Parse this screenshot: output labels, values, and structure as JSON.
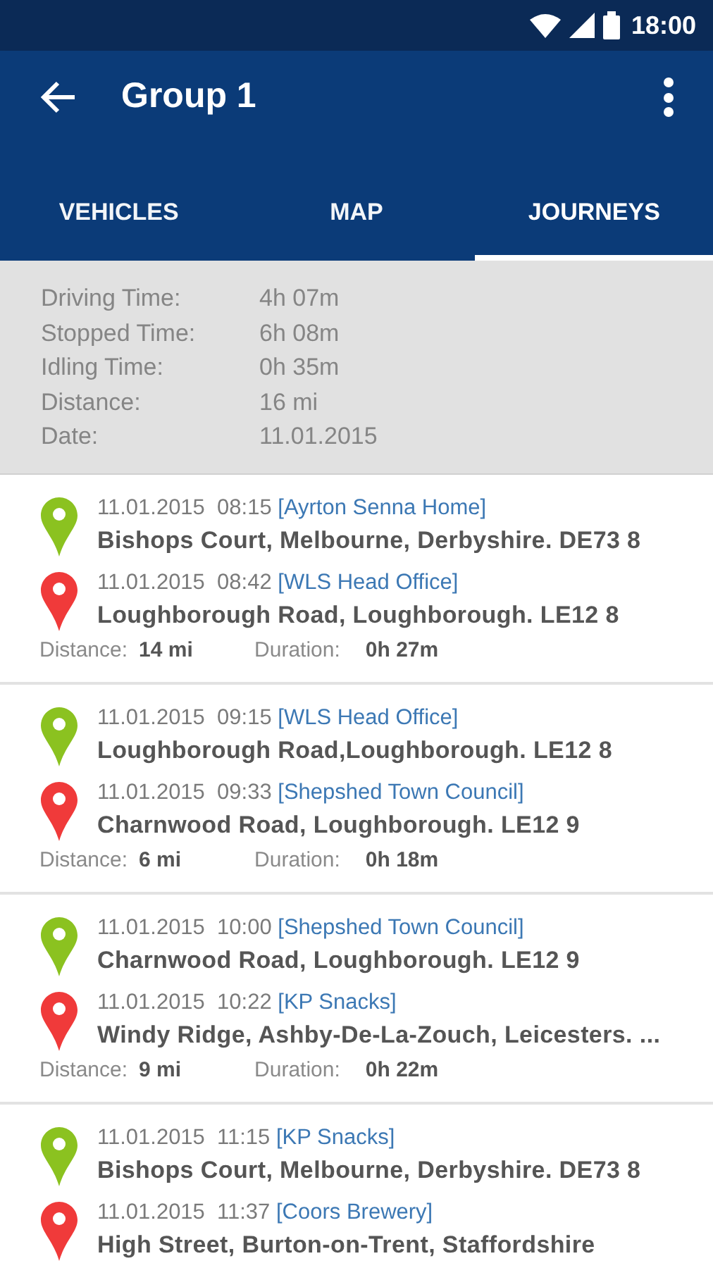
{
  "status_bar": {
    "time": "18:00"
  },
  "app_bar": {
    "title": "Group 1"
  },
  "tabs": [
    {
      "label": "VEHICLES",
      "selected": false
    },
    {
      "label": "MAP",
      "selected": false
    },
    {
      "label": "JOURNEYS",
      "selected": true
    }
  ],
  "summary": [
    {
      "label": "Driving Time:",
      "value": "4h 07m"
    },
    {
      "label": "Stopped Time:",
      "value": "6h 08m"
    },
    {
      "label": "Idling Time:",
      "value": "0h 35m"
    },
    {
      "label": "Distance:",
      "value": "16 mi"
    },
    {
      "label": "Date:",
      "value": "11.01.2015"
    }
  ],
  "journeys": [
    {
      "stops": [
        {
          "kind": "start",
          "date_time": "11.01.2015  08:15",
          "place": "[Ayrton Senna  Home]",
          "address": "Bishops Court, Melbourne, Derbyshire. DE73 8"
        },
        {
          "kind": "end",
          "date_time": "11.01.2015  08:42",
          "place": "[WLS Head Office]",
          "address": "Loughborough Road, Loughborough. LE12 8"
        }
      ],
      "distance_label": "Distance:",
      "distance": "14 mi",
      "duration_label": "Duration:",
      "duration": "0h 27m"
    },
    {
      "stops": [
        {
          "kind": "start",
          "date_time": "11.01.2015  09:15",
          "place": "[WLS Head Office]",
          "address": "Loughborough Road,Loughborough. LE12 8"
        },
        {
          "kind": "end",
          "date_time": "11.01.2015  09:33",
          "place": "[Shepshed Town Council]",
          "address": "Charnwood Road, Loughborough. LE12 9"
        }
      ],
      "distance_label": "Distance:",
      "distance": "6 mi",
      "duration_label": "Duration:",
      "duration": "0h 18m"
    },
    {
      "stops": [
        {
          "kind": "start",
          "date_time": "11.01.2015  10:00",
          "place": "[Shepshed Town Council]",
          "address": "Charnwood Road, Loughborough. LE12 9"
        },
        {
          "kind": "end",
          "date_time": "11.01.2015  10:22",
          "place": "[KP Snacks]",
          "address": "Windy Ridge, Ashby-De-La-Zouch, Leicesters. ..."
        }
      ],
      "distance_label": "Distance:",
      "distance": "9 mi",
      "duration_label": "Duration:",
      "duration": "0h 22m"
    },
    {
      "stops": [
        {
          "kind": "start",
          "date_time": "11.01.2015  11:15",
          "place": "[KP Snacks]",
          "address": "Bishops Court, Melbourne, Derbyshire. DE73 8"
        },
        {
          "kind": "end",
          "date_time": "11.01.2015  11:37",
          "place": "[Coors Brewery]",
          "address": "High Street, Burton-on-Trent, Staffordshire"
        }
      ]
    }
  ]
}
